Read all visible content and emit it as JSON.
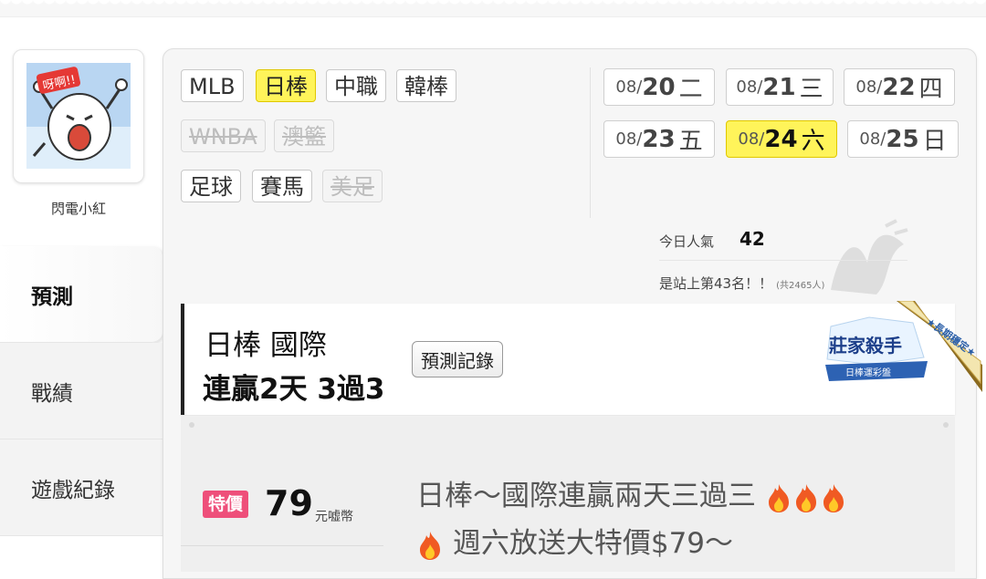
{
  "profile": {
    "username": "閃電小紅",
    "avatar_speech": "呀啊!!"
  },
  "side_nav": [
    {
      "label": "預測",
      "active": true
    },
    {
      "label": "戰績",
      "active": false
    },
    {
      "label": "遊戲紀錄",
      "active": false
    }
  ],
  "sport_tags": [
    {
      "label": "MLB",
      "state": "normal"
    },
    {
      "label": "日棒",
      "state": "active"
    },
    {
      "label": "中職",
      "state": "normal"
    },
    {
      "label": "韓棒",
      "state": "normal"
    },
    {
      "label": "WNBA",
      "state": "disabled"
    },
    {
      "label": "澳籃",
      "state": "disabled"
    },
    {
      "label": "足球",
      "state": "normal"
    },
    {
      "label": "賽馬",
      "state": "normal"
    },
    {
      "label": "美足",
      "state": "disabled"
    }
  ],
  "dates": [
    {
      "month": "08/",
      "day": "20",
      "weekday": "二",
      "active": false
    },
    {
      "month": "08/",
      "day": "21",
      "weekday": "三",
      "active": false
    },
    {
      "month": "08/",
      "day": "22",
      "weekday": "四",
      "active": false
    },
    {
      "month": "08/",
      "day": "23",
      "weekday": "五",
      "active": false
    },
    {
      "month": "08/",
      "day": "24",
      "weekday": "六",
      "active": true
    },
    {
      "month": "08/",
      "day": "25",
      "weekday": "日",
      "active": false
    }
  ],
  "popularity": {
    "label": "今日人氣",
    "value": "42",
    "rank_text": "是站上第43名！！",
    "rank_total": "(共2465人)"
  },
  "prediction": {
    "title": "日棒 國際",
    "streak": "連贏2天 3過3",
    "record_button": "預測記錄",
    "badge_main": "莊家殺手",
    "badge_sub": "日棒運彩盤",
    "badge_ribbon": "★長期穩定★"
  },
  "offer": {
    "sale_tag": "特價",
    "price": "79",
    "currency": "元嘘幣",
    "desc_line1": "日棒～國際連贏兩天三過三",
    "desc_line2": "週六放送大特價$79～"
  },
  "colors": {
    "active_yellow": "#fff45a",
    "sale_pink": "#ee4f7a"
  }
}
